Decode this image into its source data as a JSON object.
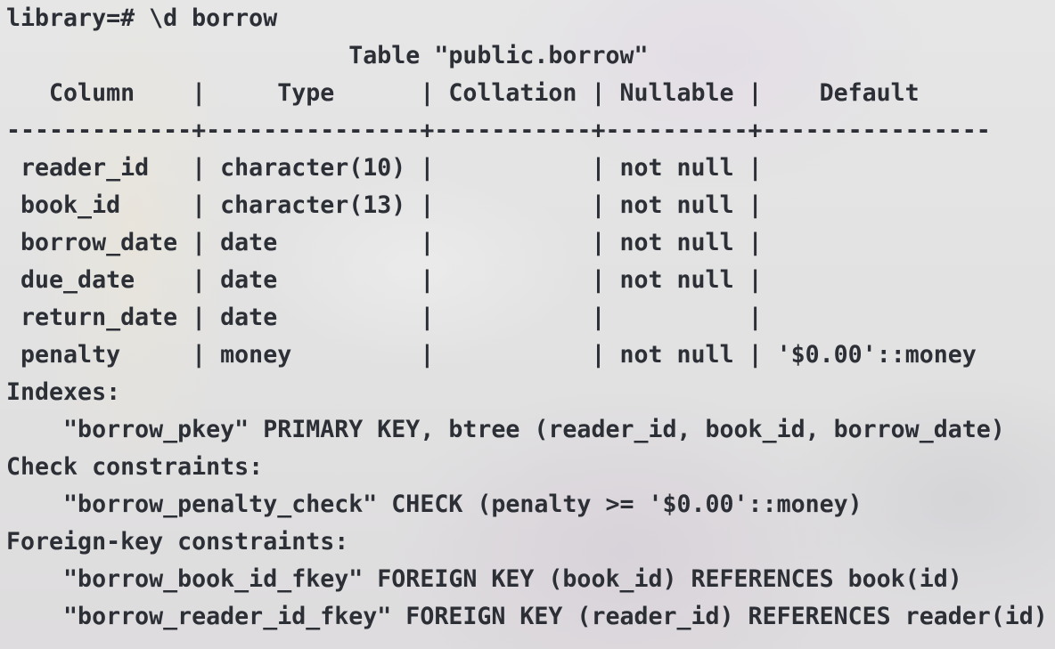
{
  "terminal": {
    "prompt": "library=# ",
    "command": "\\d borrow",
    "table_title": "Table \"public.borrow\"",
    "header": {
      "column": "Column",
      "type": "Type",
      "collation": "Collation",
      "nullable": "Nullable",
      "default": "Default"
    },
    "rows": [
      {
        "column": "reader_id",
        "type": "character(10)",
        "collation": "",
        "nullable": "not null",
        "default": ""
      },
      {
        "column": "book_id",
        "type": "character(13)",
        "collation": "",
        "nullable": "not null",
        "default": ""
      },
      {
        "column": "borrow_date",
        "type": "date",
        "collation": "",
        "nullable": "not null",
        "default": ""
      },
      {
        "column": "due_date",
        "type": "date",
        "collation": "",
        "nullable": "not null",
        "default": ""
      },
      {
        "column": "return_date",
        "type": "date",
        "collation": "",
        "nullable": "",
        "default": ""
      },
      {
        "column": "penalty",
        "type": "money",
        "collation": "",
        "nullable": "not null",
        "default": "'$0.00'::money"
      }
    ],
    "sections": [
      {
        "heading": "Indexes:",
        "items": [
          "\"borrow_pkey\" PRIMARY KEY, btree (reader_id, book_id, borrow_date)"
        ]
      },
      {
        "heading": "Check constraints:",
        "items": [
          "\"borrow_penalty_check\" CHECK (penalty >= '$0.00'::money)"
        ]
      },
      {
        "heading": "Foreign-key constraints:",
        "items": [
          "\"borrow_book_id_fkey\" FOREIGN KEY (book_id) REFERENCES book(id)",
          "\"borrow_reader_id_fkey\" FOREIGN KEY (reader_id) REFERENCES reader(id)"
        ]
      }
    ]
  }
}
